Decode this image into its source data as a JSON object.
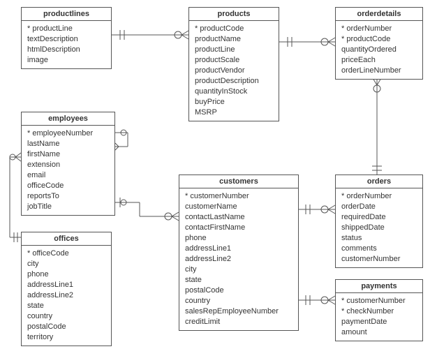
{
  "entities": {
    "productlines": {
      "title": "productlines",
      "attrs": [
        "* productLine",
        "textDescription",
        "htmlDescription",
        "image"
      ]
    },
    "products": {
      "title": "products",
      "attrs": [
        "* productCode",
        "productName",
        "productLine",
        "productScale",
        "productVendor",
        "productDescription",
        "quantityInStock",
        "buyPrice",
        "MSRP"
      ]
    },
    "orderdetails": {
      "title": "orderdetails",
      "attrs": [
        "* orderNumber",
        "* productCode",
        "quantityOrdered",
        "priceEach",
        "orderLineNumber"
      ]
    },
    "employees": {
      "title": "employees",
      "attrs": [
        "* employeeNumber",
        "lastName",
        "firstName",
        "extension",
        "email",
        "officeCode",
        "reportsTo",
        "jobTitle"
      ]
    },
    "customers": {
      "title": "customers",
      "attrs": [
        "* customerNumber",
        "customerName",
        "contactLastName",
        "contactFirstName",
        "phone",
        "addressLine1",
        "addressLine2",
        "city",
        "state",
        "postalCode",
        "country",
        "salesRepEmployeeNumber",
        "creditLimit"
      ]
    },
    "orders": {
      "title": "orders",
      "attrs": [
        "* orderNumber",
        "orderDate",
        "requiredDate",
        "shippedDate",
        "status",
        "comments",
        "customerNumber"
      ]
    },
    "offices": {
      "title": "offices",
      "attrs": [
        "* officeCode",
        "city",
        "phone",
        "addressLine1",
        "addressLine2",
        "state",
        "country",
        "postalCode",
        "territory"
      ]
    },
    "payments": {
      "title": "payments",
      "attrs": [
        "* customerNumber",
        "* checkNumber",
        "paymentDate",
        "amount"
      ]
    }
  }
}
